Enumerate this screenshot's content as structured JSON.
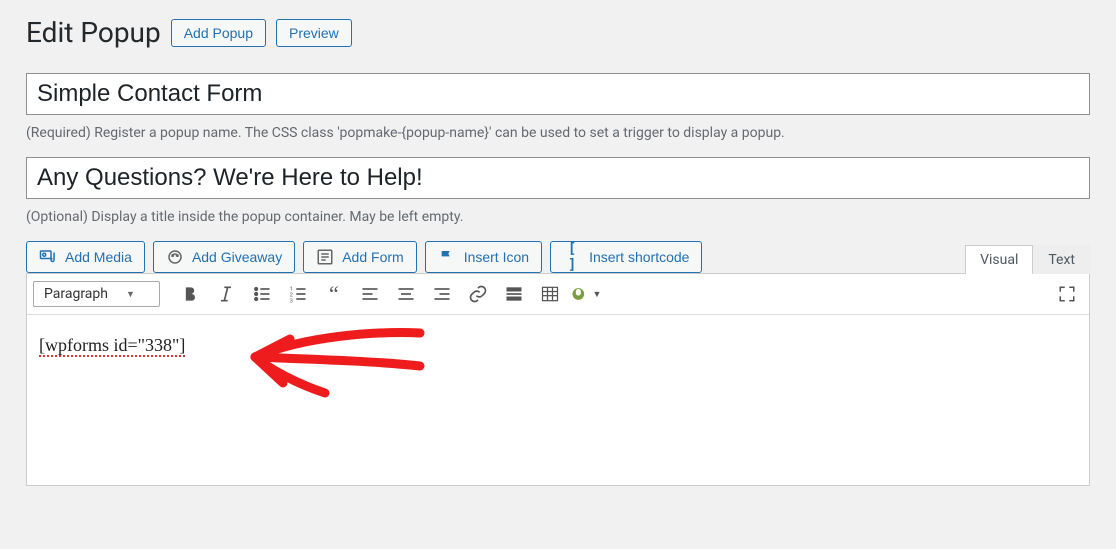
{
  "header": {
    "title": "Edit Popup",
    "add_btn": "Add Popup",
    "preview_btn": "Preview"
  },
  "fields": {
    "name_value": "Simple Contact Form",
    "name_desc": "(Required) Register a popup name. The CSS class 'popmake-{popup-name}' can be used to set a trigger to display a popup.",
    "title_value": "Any Questions? We're Here to Help!",
    "title_desc": "(Optional) Display a title inside the popup container. May be left empty."
  },
  "media_buttons": {
    "add_media": "Add Media",
    "add_giveaway": "Add Giveaway",
    "add_form": "Add Form",
    "insert_icon": "Insert Icon",
    "insert_shortcode": "Insert shortcode"
  },
  "tabs": {
    "visual": "Visual",
    "text": "Text"
  },
  "toolbar": {
    "format": "Paragraph"
  },
  "editor": {
    "content": "[wpforms id=\"338\"]"
  }
}
